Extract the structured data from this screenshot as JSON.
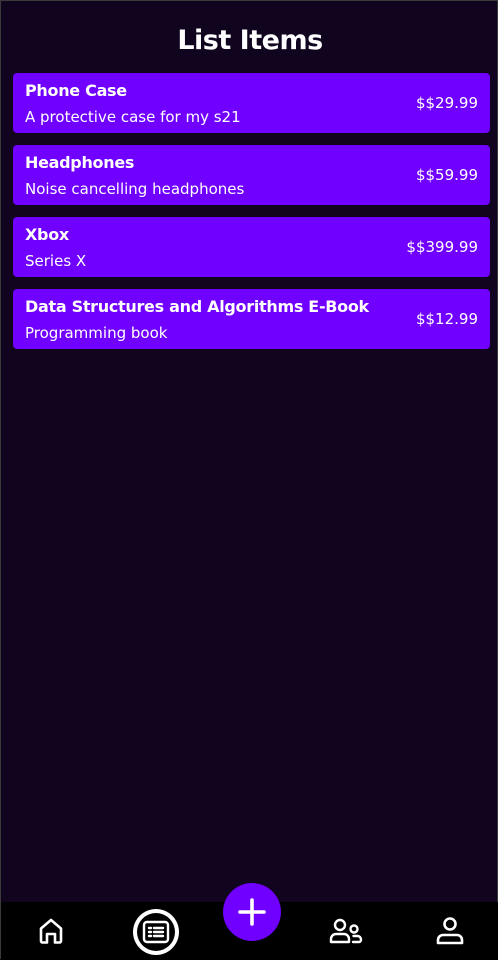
{
  "header": {
    "title": "List Items"
  },
  "items": [
    {
      "name": "Phone Case",
      "description": "A protective case for my s21",
      "price": "$$29.99"
    },
    {
      "name": "Headphones",
      "description": "Noise cancelling headphones",
      "price": "$$59.99"
    },
    {
      "name": "Xbox",
      "description": "Series X",
      "price": "$$399.99"
    },
    {
      "name": "Data Structures and Algorithms E-Book",
      "description": "Programming book",
      "price": "$$12.99"
    }
  ],
  "bottom_nav": {
    "items": [
      {
        "icon": "home-icon"
      },
      {
        "icon": "list-icon",
        "active": true
      },
      {
        "icon": "plus-icon"
      },
      {
        "icon": "friends-icon"
      },
      {
        "icon": "profile-icon"
      }
    ]
  },
  "colors": {
    "background": "#10041f",
    "accent": "#7000ff",
    "nav_background": "#000000",
    "text": "#ffffff"
  }
}
